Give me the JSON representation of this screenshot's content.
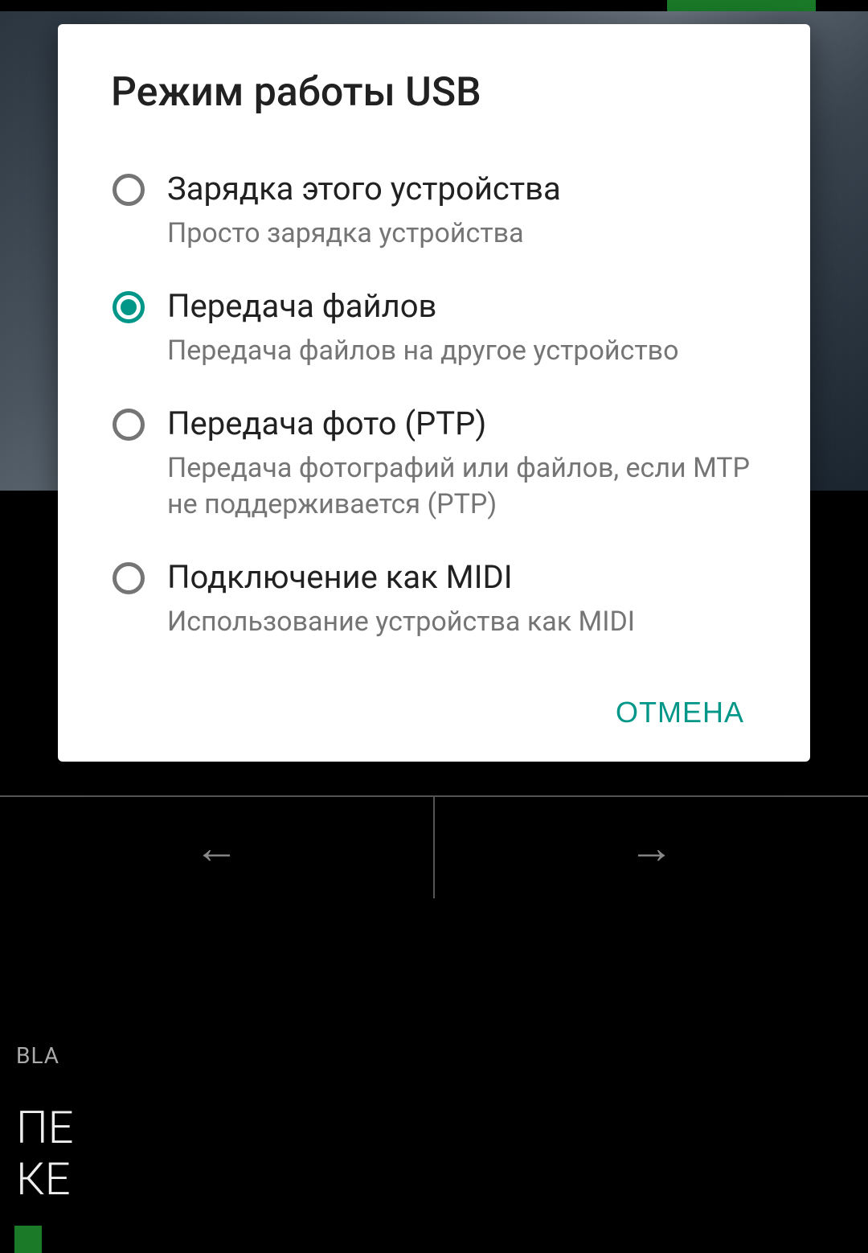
{
  "dialog": {
    "title": "Режим работы USB",
    "options": [
      {
        "label": "Зарядка этого устройства",
        "desc": "Просто зарядка устройства",
        "selected": false
      },
      {
        "label": "Передача файлов",
        "desc": "Передача файлов на другое устройство",
        "selected": true
      },
      {
        "label": "Передача фото (PTP)",
        "desc": "Передача фотографий или файлов, если MTP не поддерживается (PTP)",
        "selected": false
      },
      {
        "label": "Подключение как MIDI",
        "desc": "Использование устройства как MIDI",
        "selected": false
      }
    ],
    "cancel": "ОТМЕНА"
  },
  "background": {
    "tag": "BLA",
    "line1": "ПЕ",
    "line2": "КЕ"
  }
}
